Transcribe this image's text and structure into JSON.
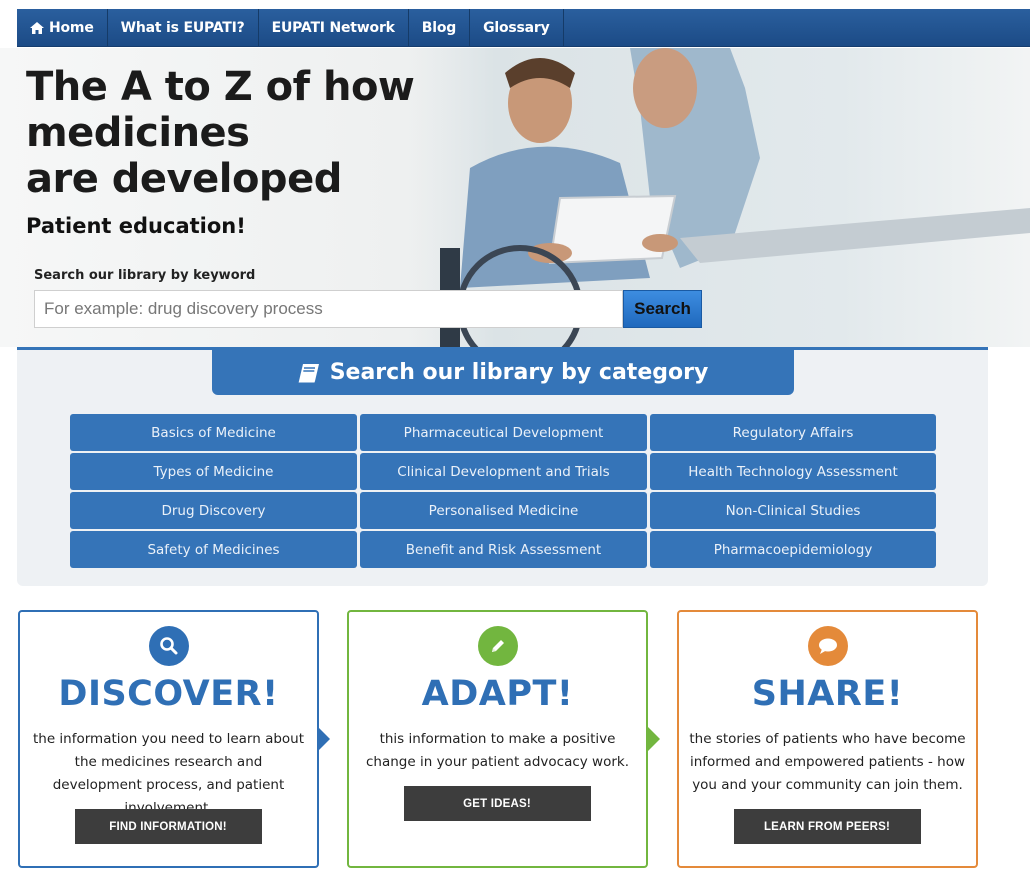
{
  "nav": {
    "items": [
      {
        "label": "Home",
        "icon": "home-icon"
      },
      {
        "label": "What is EUPATI?"
      },
      {
        "label": "EUPATI Network"
      },
      {
        "label": "Blog"
      },
      {
        "label": "Glossary"
      }
    ]
  },
  "hero": {
    "title": "The A to Z of how\nmedicines\nare developed",
    "subtitle": "Patient education!",
    "search_label": "Search our library by keyword",
    "search_placeholder": "For example: drug discovery process",
    "search_button": "Search"
  },
  "categories": {
    "title": "Search our library by category",
    "icon": "book-icon",
    "items": [
      "Basics of Medicine",
      "Pharmaceutical Development",
      "Regulatory Affairs",
      "Types of Medicine",
      "Clinical Development and Trials",
      "Health Technology Assessment",
      "Drug Discovery",
      "Personalised Medicine",
      "Non-Clinical Studies",
      "Safety of Medicines",
      "Benefit and Risk Assessment",
      "Pharmacoepidemiology"
    ]
  },
  "cards": [
    {
      "icon": "search-icon",
      "heading": "DISCOVER!",
      "text": "the information you need to learn about the medicines research and development process, and patient involvement.",
      "button": "FIND INFORMATION!",
      "color": "#2f6fb5"
    },
    {
      "icon": "pencil-icon",
      "heading": "ADAPT!",
      "text": "this information to make a positive change in your patient advocacy work.",
      "button": "GET IDEAS!",
      "color": "#72b63f"
    },
    {
      "icon": "speech-bubble-icon",
      "heading": "SHARE!",
      "text": "the stories of patients who have become informed and empowered patients - how you and your community can join them.",
      "button": "LEARN FROM PEERS!",
      "color": "#e48a3a"
    }
  ],
  "colors": {
    "brand_blue": "#3574b8",
    "nav_blue": "#1f4f8c",
    "dark_button": "#3d3d3d"
  }
}
